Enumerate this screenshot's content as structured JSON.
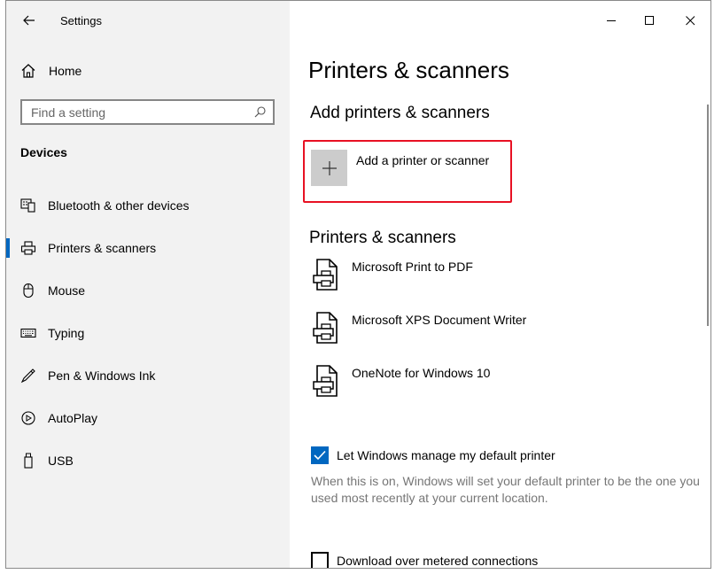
{
  "window": {
    "title": "Settings",
    "controls": {
      "minimize": "minimize-icon",
      "maximize": "maximize-icon",
      "close": "close-icon"
    }
  },
  "sidebar": {
    "home_label": "Home",
    "search": {
      "placeholder": "Find a setting",
      "value": ""
    },
    "section_title": "Devices",
    "items": [
      {
        "label": "Bluetooth & other devices",
        "icon": "bluetooth-devices-icon",
        "active": false
      },
      {
        "label": "Printers & scanners",
        "icon": "printer-icon",
        "active": true
      },
      {
        "label": "Mouse",
        "icon": "mouse-icon",
        "active": false
      },
      {
        "label": "Typing",
        "icon": "keyboard-icon",
        "active": false
      },
      {
        "label": "Pen & Windows Ink",
        "icon": "pen-icon",
        "active": false
      },
      {
        "label": "AutoPlay",
        "icon": "autoplay-icon",
        "active": false
      },
      {
        "label": "USB",
        "icon": "usb-icon",
        "active": false
      }
    ]
  },
  "main": {
    "page_title": "Printers & scanners",
    "add_section_title": "Add printers & scanners",
    "add_button_label": "Add a printer or scanner",
    "list_title": "Printers & scanners",
    "printers": [
      {
        "name": "Microsoft Print to PDF"
      },
      {
        "name": "Microsoft XPS Document Writer"
      },
      {
        "name": "OneNote for Windows 10"
      }
    ],
    "default_printer": {
      "label": "Let Windows manage my default printer",
      "checked": true,
      "description": "When this is on, Windows will set your default printer to be the one you used most recently at your current location."
    },
    "metered": {
      "label": "Download over metered connections",
      "checked": false
    }
  },
  "colors": {
    "accent": "#0067c0",
    "highlight_border": "#e81123",
    "sidebar_bg": "#f2f2f2"
  }
}
